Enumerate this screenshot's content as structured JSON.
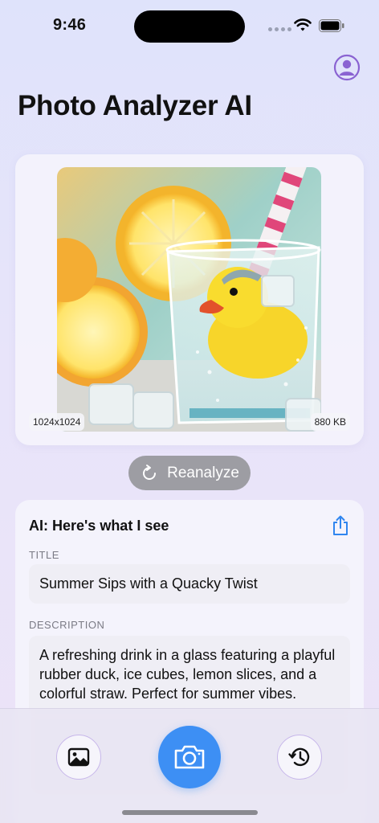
{
  "status_bar": {
    "time": "9:46"
  },
  "header": {
    "title": "Photo Analyzer AI",
    "profile_icon": "person-circle-icon"
  },
  "image": {
    "resolution": "1024x1024",
    "file_size": "880 KB"
  },
  "reanalyze": {
    "label": "Reanalyze",
    "icon": "refresh-icon"
  },
  "analysis": {
    "heading": "AI: Here's what I see",
    "share_icon": "share-icon",
    "title_label": "TITLE",
    "title_value": "Summer Sips with a Quacky Twist",
    "description_label": "DESCRIPTION",
    "description_value": "A refreshing drink in a glass featuring a playful rubber duck, ice cubes, lemon slices, and a colorful straw. Perfect for summer vibes."
  },
  "bottom_bar": {
    "gallery_icon": "photo-gallery-icon",
    "camera_icon": "camera-icon",
    "history_icon": "history-icon"
  },
  "colors": {
    "accent": "#3d8ff4",
    "profile": "#8a63d2",
    "reanalyze_bg": "#9d9da3"
  }
}
